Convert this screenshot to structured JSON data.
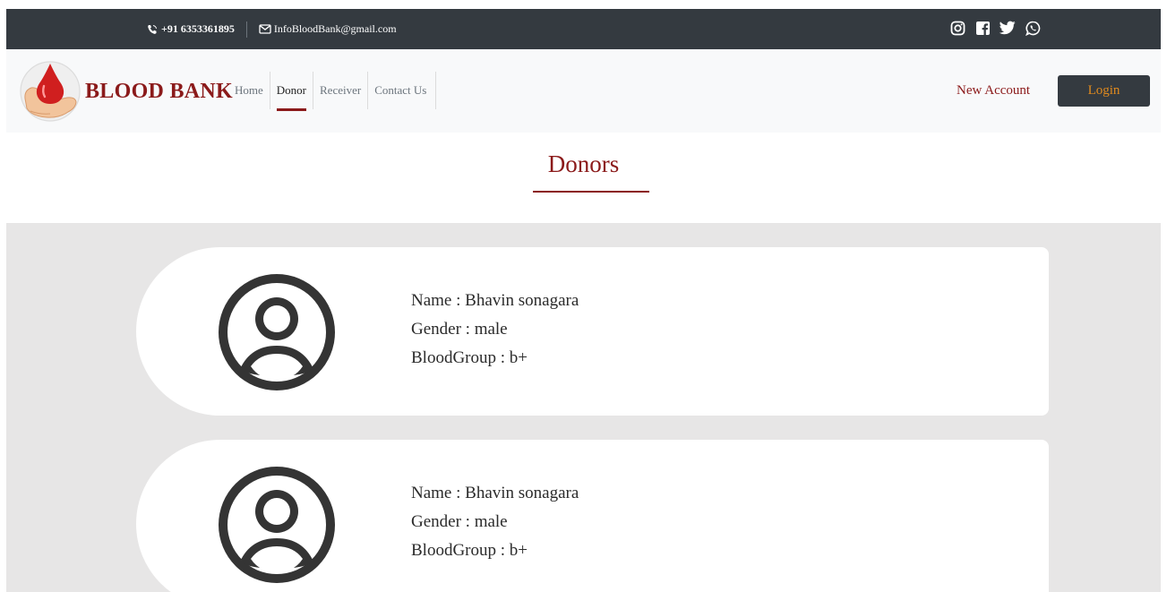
{
  "topbar": {
    "phone": "+91 6353361895",
    "email": "InfoBloodBank@gmail.com",
    "socials": [
      "instagram-icon",
      "facebook-icon",
      "twitter-icon",
      "whatsapp-icon"
    ]
  },
  "navbar": {
    "brand": "BLOOD BANK",
    "links": [
      {
        "label": "Home",
        "active": false
      },
      {
        "label": "Donor",
        "active": true
      },
      {
        "label": "Receiver",
        "active": false
      },
      {
        "label": "Contact Us",
        "active": false
      }
    ],
    "new_account": "New Account",
    "login": "Login"
  },
  "page": {
    "title": "Donors"
  },
  "donors": [
    {
      "name": "Name : Bhavin sonagara",
      "gender": "Gender : male",
      "blood_group": "BloodGroup : b+"
    },
    {
      "name": "Name : Bhavin sonagara",
      "gender": "Gender : male",
      "blood_group": "BloodGroup : b+"
    }
  ],
  "colors": {
    "accent": "#8b1a1a",
    "dark": "#343a40",
    "login_text": "#e08a1e",
    "list_background": "#e7e6e6"
  }
}
